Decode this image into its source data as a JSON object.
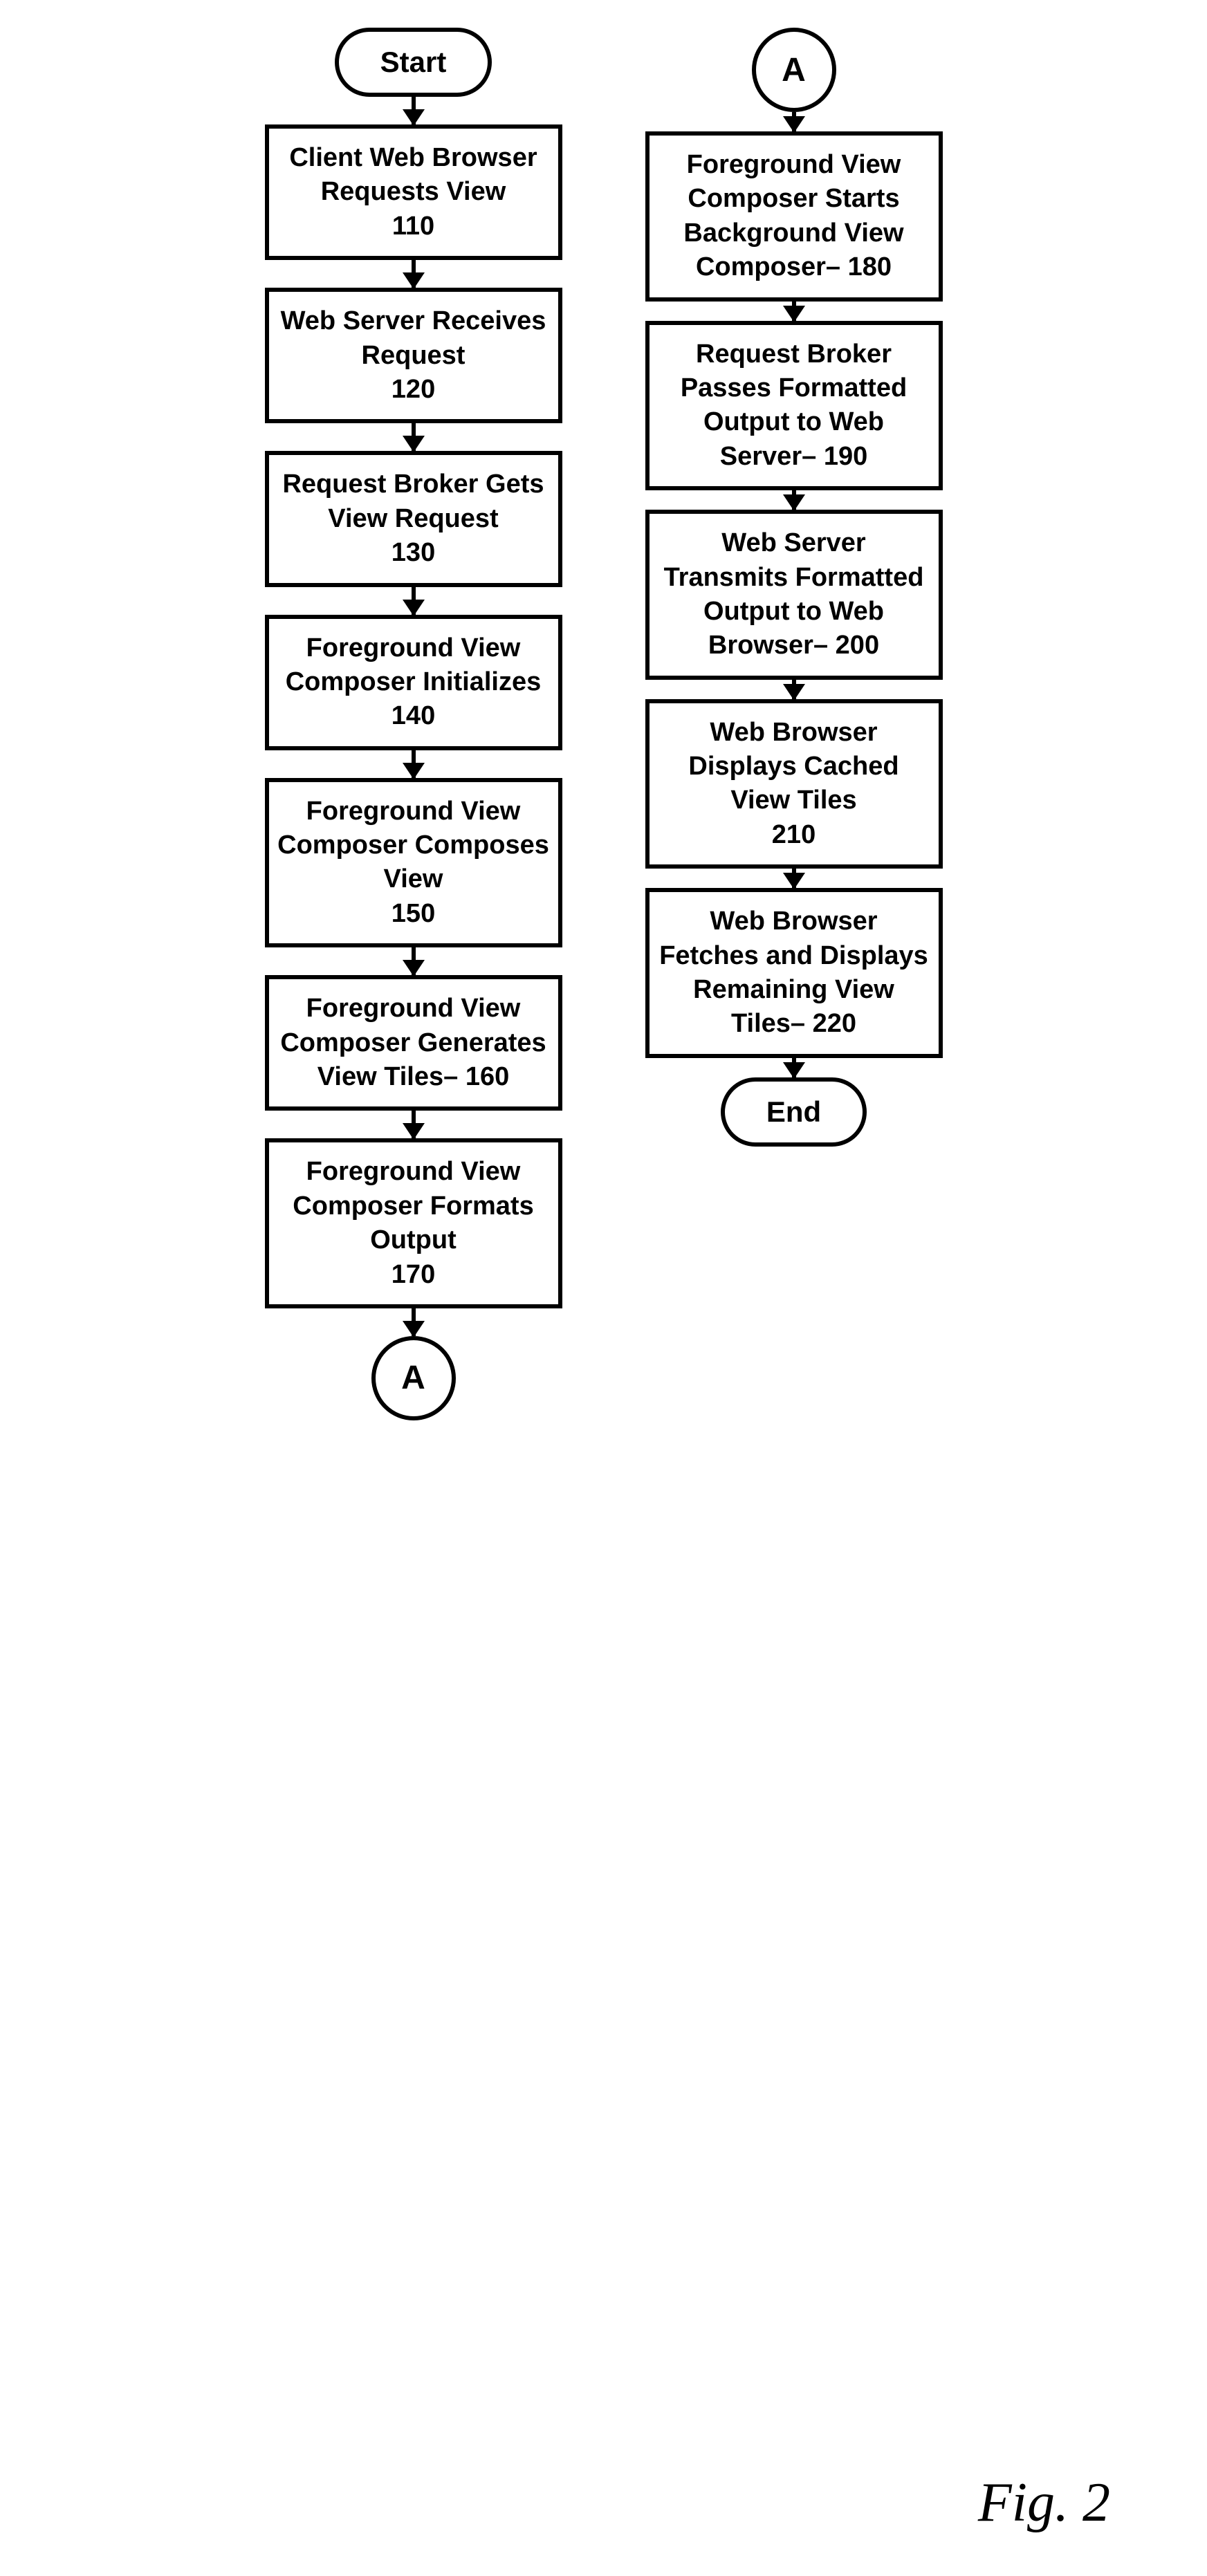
{
  "col1": {
    "start": "Start",
    "connectorBottom": "A",
    "steps": [
      {
        "text": "Client Web Browser Requests View",
        "num": "110"
      },
      {
        "text": "Web Server Receives Request",
        "num": "120"
      },
      {
        "text": "Request Broker Gets View Request",
        "num": "130"
      },
      {
        "text": "Foreground View Composer Initializes",
        "num": "140"
      },
      {
        "text": "Foreground View Composer Composes View",
        "num": "150"
      },
      {
        "text": "Foreground View Composer Generates View Tiles–",
        "num": "160"
      },
      {
        "text": "Foreground View Composer Formats Output",
        "num": "170"
      }
    ]
  },
  "col2": {
    "connectorTop": "A",
    "end": "End",
    "steps": [
      {
        "text": "Foreground View Composer Starts Background View Composer–",
        "num": "180"
      },
      {
        "text": "Request Broker Passes Formatted Output to Web Server–",
        "num": "190"
      },
      {
        "text": "Web Server Transmits Formatted Output to Web Browser–",
        "num": "200"
      },
      {
        "text": "Web Browser Displays Cached View Tiles",
        "num": "210"
      },
      {
        "text": "Web Browser Fetches and Displays Remaining View Tiles–",
        "num": "220"
      }
    ]
  },
  "figLabel": "Fig.  2"
}
